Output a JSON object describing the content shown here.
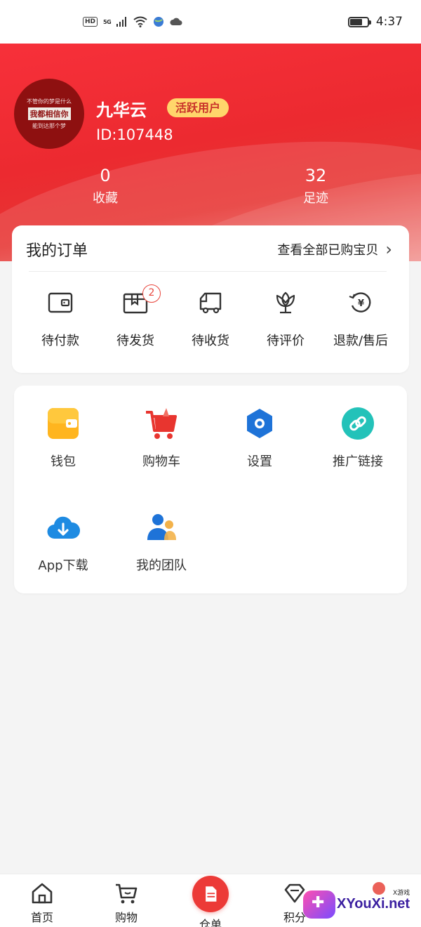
{
  "status_bar": {
    "hd": "HD",
    "signal": "5G",
    "time": "4:37"
  },
  "profile": {
    "avatar_lines": [
      "不管你的梦是什么",
      "我都相信你",
      "能到达那个梦"
    ],
    "name": "九华云",
    "badge": "活跃用户",
    "id": "ID:107448",
    "stats": [
      {
        "value": "0",
        "label": "收藏"
      },
      {
        "value": "32",
        "label": "足迹"
      }
    ]
  },
  "orders": {
    "title": "我的订单",
    "view_all": "查看全部已购宝贝",
    "items": [
      {
        "label": "待付款",
        "icon": "wallet-outline-icon"
      },
      {
        "label": "待发货",
        "icon": "package-icon",
        "badge": "2"
      },
      {
        "label": "待收货",
        "icon": "truck-icon"
      },
      {
        "label": "待评价",
        "icon": "flower-icon"
      },
      {
        "label": "退款/售后",
        "icon": "refund-yen-icon"
      }
    ]
  },
  "tools": [
    {
      "label": "钱包",
      "icon": "wallet-icon"
    },
    {
      "label": "购物车",
      "icon": "cart-icon"
    },
    {
      "label": "设置",
      "icon": "settings-hex-icon"
    },
    {
      "label": "推广链接",
      "icon": "link-icon"
    },
    {
      "label": "App下载",
      "icon": "cloud-download-icon"
    },
    {
      "label": "我的团队",
      "icon": "team-icon"
    }
  ],
  "bottom_nav": [
    {
      "label": "首页",
      "icon": "home-icon"
    },
    {
      "label": "购物",
      "icon": "shopping-cart-icon"
    },
    {
      "label": "仓单",
      "icon": "document-icon"
    },
    {
      "label": "积分",
      "icon": "diamond-icon"
    }
  ],
  "watermark": {
    "site": "XYouXi.net",
    "tag": "X游戏"
  },
  "colors": {
    "brand_red": "#ec2a30",
    "badge_yellow": "#ffd66b",
    "badge_text": "#c9322a"
  }
}
